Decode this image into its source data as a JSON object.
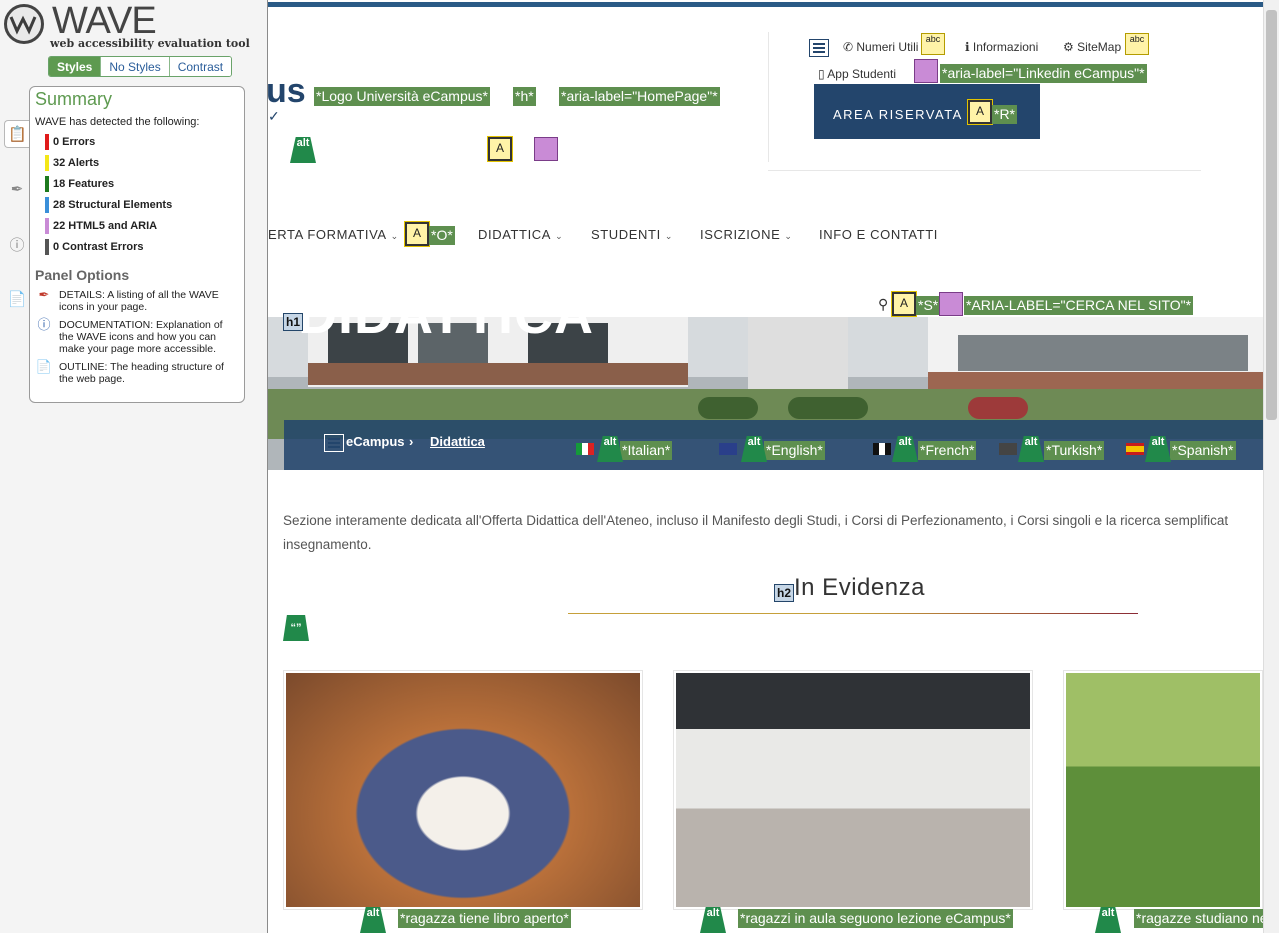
{
  "wave": {
    "brand": "WAVE",
    "tagline": "web accessibility evaluation tool",
    "modes": [
      "Styles",
      "No Styles",
      "Contrast"
    ],
    "summary_title": "Summary",
    "detected": "WAVE has detected the following:",
    "categories": [
      {
        "label": "0 Errors",
        "color": "#e01b1b"
      },
      {
        "label": "32 Alerts",
        "color": "#f4e718"
      },
      {
        "label": "18 Features",
        "color": "#1d7a1d"
      },
      {
        "label": "28 Structural Elements",
        "color": "#3a8fd9"
      },
      {
        "label": "22 HTML5 and ARIA",
        "color": "#c98bd6"
      },
      {
        "label": "0 Contrast Errors",
        "color": "#555555"
      }
    ],
    "panel_options_title": "Panel Options",
    "options": [
      {
        "icon": "details-icon",
        "text": "DETAILS: A listing of all the WAVE icons in your page."
      },
      {
        "icon": "documentation-icon",
        "text": "DOCUMENTATION: Explanation of the WAVE icons and how you can make your page more accessible."
      },
      {
        "icon": "outline-icon",
        "text": "OUTLINE: The heading structure of the web page."
      }
    ]
  },
  "header": {
    "logo_partial": "us",
    "wave_labels": {
      "logo": "*Logo Università eCampus*",
      "h": "*h*",
      "homepage": "*aria-label=\"HomePage\"*",
      "linkedin": "*aria-label=\"Linkedin eCampus\"*",
      "r": "*R*",
      "o": "*O*",
      "s": "*S*",
      "search": "*ARIA-LABEL=\"CERCA NEL SITO\"*"
    },
    "utility": {
      "numeri": "Numeri Utili",
      "informazioni": "Informazioni",
      "sitemap": "SiteMap",
      "app": "App Studenti"
    },
    "area_riservata": "AREA RISERVATA",
    "nav": [
      "ERTA FORMATIVA",
      "DIDATTICA",
      "STUDENTI",
      "ISCRIZIONE",
      "INFO E CONTATTI"
    ]
  },
  "hero": {
    "page_heading_fragment": "DIDATTICA",
    "breadcrumb": [
      "eCampus",
      "Didattica"
    ],
    "languages": [
      "*Italian*",
      "*English*",
      "*French*",
      "*Turkish*",
      "*Spanish*"
    ]
  },
  "content": {
    "intro": "Sezione interamente dedicata all'Offerta Didattica dell'Ateneo, incluso il Manifesto degli Studi, i Corsi di Perfezionamento, i Corsi singoli e la ricerca semplificat insegnamento.",
    "section_title": "In Evidenza",
    "cards": [
      {
        "caption": "*ragazza tiene libro aperto*"
      },
      {
        "caption": "*ragazzi in aula seguono lezione eCampus*"
      },
      {
        "caption": "*ragazze studiano ne"
      }
    ]
  }
}
